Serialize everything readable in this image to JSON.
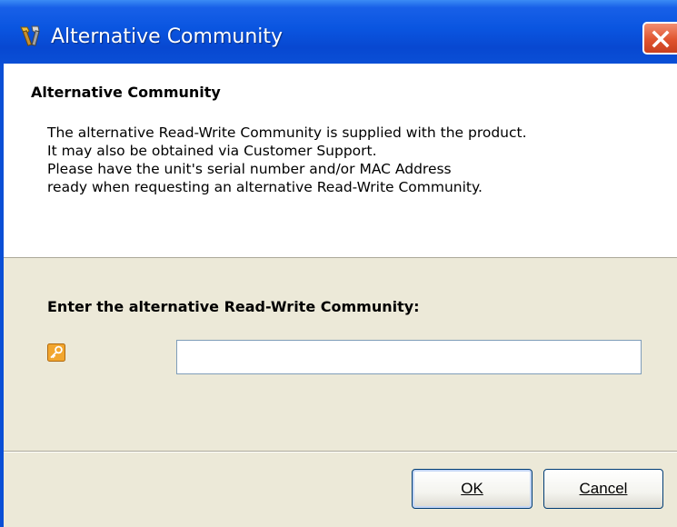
{
  "window": {
    "title": "Alternative Community",
    "close_icon": "close-icon"
  },
  "header": {
    "title": "Alternative Community",
    "description_lines": [
      "The alternative Read-Write Community is supplied with the product.",
      "It may also be obtained via Customer Support.",
      "Please have the unit's serial number and/or MAC Address",
      "ready when requesting an alternative Read-Write Community."
    ]
  },
  "form": {
    "prompt_label": "Enter the alternative Read-Write Community:",
    "field_icon": "key-icon",
    "community_value": ""
  },
  "buttons": {
    "ok_label": "OK",
    "cancel_label": "Cancel"
  },
  "colors": {
    "titlebar": "#0a55e0",
    "close_button": "#e0542f",
    "dialog_background": "#ece9d8",
    "header_background": "#ffffff"
  }
}
